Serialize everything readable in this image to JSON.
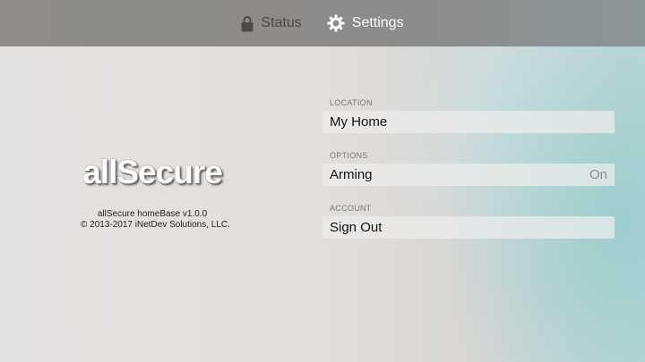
{
  "nav": {
    "tabs": [
      {
        "label": "Status",
        "icon": "lock-icon"
      },
      {
        "label": "Settings",
        "icon": "gear-icon",
        "selected": true
      }
    ]
  },
  "brand": {
    "logo": "allSecure",
    "version": "allSecure homeBase v1.0.0",
    "copyright": "© 2013-2017 iNetDev Solutions, LLC."
  },
  "settings": {
    "location": {
      "header": "LOCATION",
      "item": "My Home"
    },
    "options": {
      "header": "OPTIONS",
      "item": "Arming",
      "value": "On"
    },
    "account": {
      "header": "ACCOUNT",
      "item": "Sign Out"
    }
  },
  "colors": {
    "topbar": "#8f8c89",
    "selected_tab_text": "#ffffff",
    "unselected_tab_text": "#4a4a4a"
  }
}
